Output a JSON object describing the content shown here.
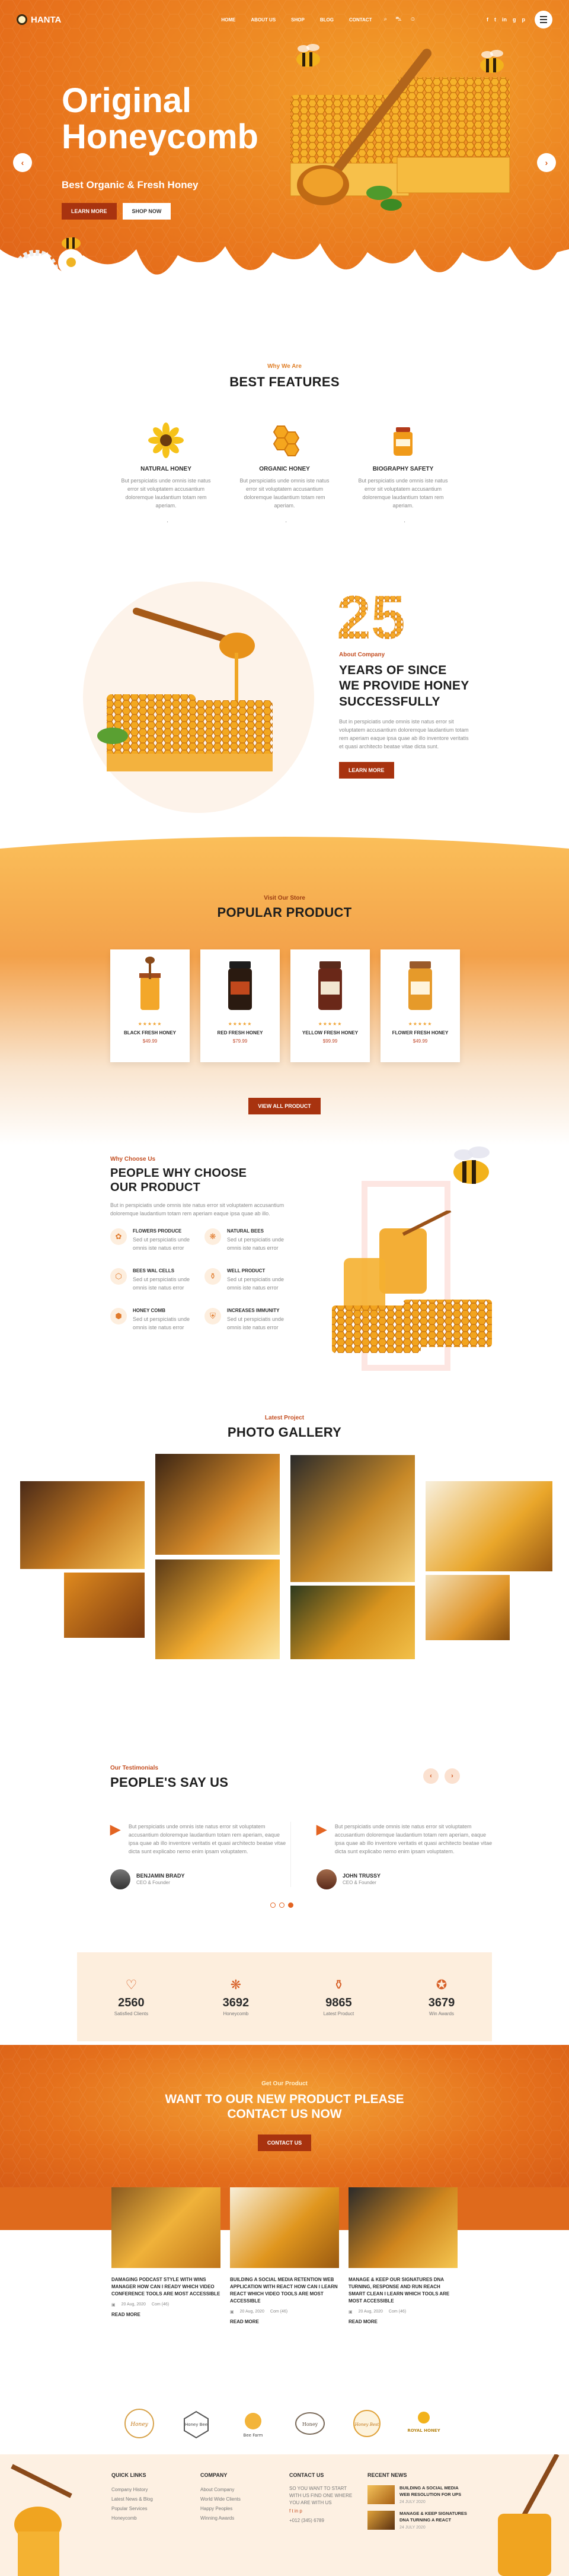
{
  "header": {
    "brand": "HANTA",
    "nav": [
      "HOME",
      "ABOUT US",
      "SHOP",
      "BLOG",
      "CONTACT"
    ],
    "icons": [
      "search-icon",
      "cart-icon",
      "user-icon"
    ],
    "social": [
      "f",
      "t",
      "in",
      "g",
      "p"
    ]
  },
  "hero": {
    "title_line1": "Original",
    "title_line2": "Honeycomb",
    "subtitle": "Best Organic & Fresh Honey",
    "btn_primary": "LEARN MORE",
    "btn_secondary": "SHOP NOW"
  },
  "features": {
    "kicker": "Why We Are",
    "title": "BEST FEATURES",
    "items": [
      {
        "title": "NATURAL HONEY",
        "text": "But perspiciatis unde omnis iste natus error sit voluptatem accusantium doloremque laudantium totam rem aperiam."
      },
      {
        "title": "ORGANIC HONEY",
        "text": "But perspiciatis unde omnis iste natus error sit voluptatem accusantium doloremque laudantium totam rem aperiam."
      },
      {
        "title": "BIOGRAPHY SAFETY",
        "text": "But perspiciatis unde omnis iste natus error sit voluptatem accusantium doloremque laudantium totam rem aperiam."
      }
    ]
  },
  "about": {
    "big_number": "25",
    "kicker": "About Company",
    "title": "YEARS OF SINCE WE PROVIDE HONEY SUCCESSFULLY",
    "text": "But in perspiciatis unde omnis iste natus error sit voluptatem accusantium doloremque laudantium totam rem aperiam eaque ipsa quae ab illo inventore veritatis et quasi architecto beatae vitae dicta sunt.",
    "btn": "LEARN MORE"
  },
  "popular": {
    "kicker": "Visit Our Store",
    "title": "POPULAR PRODUCT",
    "products": [
      {
        "name": "BLACK FRESH HONEY",
        "price": "$49.99",
        "stars": "★★★★★"
      },
      {
        "name": "RED FRESH HONEY",
        "price": "$79.99",
        "stars": "★★★★★"
      },
      {
        "name": "YELLOW FRESH HONEY",
        "price": "$99.99",
        "stars": "★★★★★"
      },
      {
        "name": "FLOWER FRESH HONEY",
        "price": "$49.99",
        "stars": "★★★★★"
      }
    ],
    "btn": "VIEW ALL PRODUCT"
  },
  "why": {
    "kicker": "Why Choose Us",
    "title_line1": "PEOPLE WHY CHOOSE",
    "title_line2": "OUR PRODUCT",
    "intro": "But in perspiciatis unde omnis iste natus error sit voluptatem accusantium doloremque laudantium totam rem aperiam eaque ipsa quae ab illo.",
    "items": [
      {
        "title": "FLOWERS PRODUCE",
        "text": "Sed ut perspiciatis unde omnis iste natus error"
      },
      {
        "title": "NATURAL BEES",
        "text": "Sed ut perspiciatis unde omnis iste natus error"
      },
      {
        "title": "BEES WAL CELLS",
        "text": "Sed ut perspiciatis unde omnis iste natus error"
      },
      {
        "title": "WELL PRODUCT",
        "text": "Sed ut perspiciatis unde omnis iste natus error"
      },
      {
        "title": "HONEY COMB",
        "text": "Sed ut perspiciatis unde omnis iste natus error"
      },
      {
        "title": "INCREASES IMMUNITY",
        "text": "Sed ut perspiciatis unde omnis iste natus error"
      }
    ]
  },
  "gallery": {
    "kicker": "Latest Project",
    "title": "PHOTO GALLERY"
  },
  "testimonials": {
    "kicker": "Our Testimonials",
    "title": "PEOPLE'S SAY US",
    "items": [
      {
        "text": "But perspiciatis unde omnis iste natus error sit voluptatem accusantium doloremque laudantium totam rem aperiam, eaque ipsa quae ab illo inventore veritatis et quasi architecto beatae vitae dicta sunt explicabo nemo enim ipsam voluptatem.",
        "name": "BENJAMIN BRADY",
        "role": "CEO & Founder"
      },
      {
        "text": "But perspiciatis unde omnis iste natus error sit voluptatem accusantium doloremque laudantium totam rem aperiam, eaque ipsa quae ab illo inventore veritatis et quasi architecto beatae vitae dicta sunt explicabo nemo enim ipsam voluptatem.",
        "name": "JOHN TRUSSY",
        "role": "CEO & Founder"
      }
    ]
  },
  "counters": [
    {
      "value": "2560",
      "label": "Satisfied Clients"
    },
    {
      "value": "3692",
      "label": "Honeycomb"
    },
    {
      "value": "9865",
      "label": "Latest Product"
    },
    {
      "value": "3679",
      "label": "Win Awards"
    }
  ],
  "newsletter": {
    "kicker": "Get Our Product",
    "title_line1": "WANT TO OUR NEW PRODUCT PLEASE",
    "title_line2": "CONTACT US NOW",
    "btn": "CONTACT US"
  },
  "blog": [
    {
      "title": "DAMAGING PODCAST STYLE WITH WINS MANAGER HOW CAN I READY WHICH VIDEO CONFERENCE TOOLS ARE MOST ACCESSIBLE",
      "date": "20 Aug, 2020",
      "comments": "Com (46)",
      "rm": "READ MORE"
    },
    {
      "title": "BUILDING A SOCIAL MEDIA RETENTION WEB APPLICATION WITH REACT HOW CAN I LEARN REACT WHICH VIDEO TOOLS ARE MOST ACCESSIBLE",
      "date": "20 Aug, 2020",
      "comments": "Com (46)",
      "rm": "READ MORE"
    },
    {
      "title": "MANAGE & KEEP OUR SIGNATURES DNA TURNING, RESPONSE AND RUN REACH SMART CLEAN I LEARN WHICH TOOLS ARE MOST ACCESSIBLE",
      "date": "20 Aug, 2020",
      "comments": "Com (46)",
      "rm": "READ MORE"
    }
  ],
  "brands": [
    "Honey",
    "Honey Bee",
    "Bee Farm",
    "Honey",
    "Honey Best",
    "ROYAL HONEY"
  ],
  "footer": {
    "cols": [
      {
        "title": "QUICK LINKS",
        "links": [
          "Company History",
          "Latest News & Blog",
          "Popular Services",
          "Honeycomb"
        ]
      },
      {
        "title": "COMPANY",
        "links": [
          "About Company",
          "World Wide Clients",
          "Happy Peoples",
          "Winning Awards"
        ]
      },
      {
        "title": "CONTACT US",
        "links": [
          "SO YOU WANT TO START WITH US FIND ONE WHERE YOU ARE WITH US",
          "f   t   in   p",
          "+012 (345) 6789"
        ]
      }
    ],
    "news_title": "RECENT NEWS",
    "news": [
      {
        "title": "BUILDING A SOCIAL MEDIA WEB RESOLUTION FOR UPS",
        "date": "24 JULY 2020"
      },
      {
        "title": "MANAGE & KEEP SIGNATURES DNA TURNING A REACT",
        "date": "24 JULY 2020"
      }
    ]
  }
}
